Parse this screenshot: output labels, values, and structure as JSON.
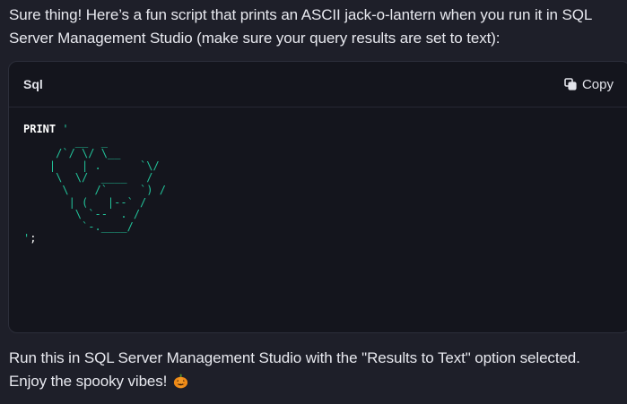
{
  "message": {
    "intro": "Sure thing! Here’s a fun script that prints an ASCII jack-o-lantern when you run it in SQL Server Management Studio (make sure your query results are set to text):",
    "outro_line1": "Run this in SQL Server Management Studio with the \"Results to Text\" option selected.",
    "outro_line2": "Enjoy the spooky vibes!",
    "emoji_icon": "jack-o-lantern-icon"
  },
  "code_block": {
    "language": "Sql",
    "copy_label": "Copy",
    "copy_icon": "copy-icon",
    "keyword": "PRINT",
    "string_open": "'",
    "ascii_art": "        __  _\n     /`/ \\/ \\__\n    |    | .      `\\/\n     \\  \\/  ____   /\n      \\    /`     `) /\n       | (   |--` /\n        \\ `--  . /\n         `-.____/",
    "string_close": "'",
    "terminator": ";"
  },
  "colors": {
    "background": "#1e1f29",
    "code_background": "#14151d",
    "string_green": "#22c39a",
    "text": "#e8e9ef"
  }
}
